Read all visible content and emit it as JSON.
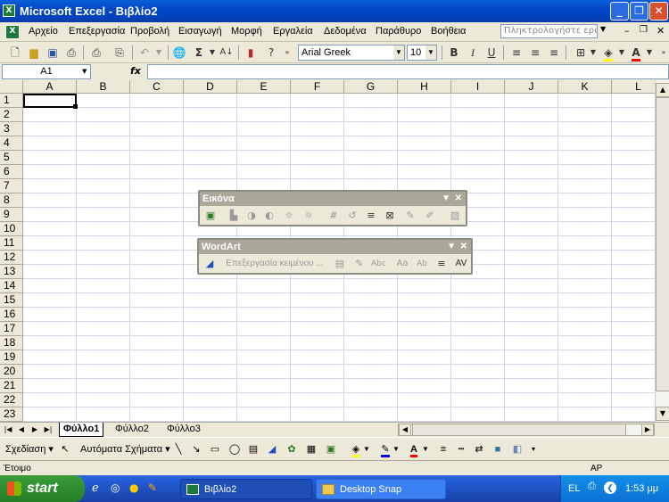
{
  "window": {
    "title": "Microsoft Excel - Βιβλίο2"
  },
  "menu": {
    "items": [
      "Αρχείο",
      "Επεξεργασία",
      "Προβολή",
      "Εισαγωγή",
      "Μορφή",
      "Εργαλεία",
      "Δεδομένα",
      "Παράθυρο",
      "Βοήθεια"
    ],
    "help_placeholder": "Πληκτρολογήστε ερώτηση"
  },
  "formatting": {
    "font": "Arial Greek",
    "size": "10"
  },
  "formula_bar": {
    "name_box": "A1",
    "fx": "fx"
  },
  "grid": {
    "columns": [
      "A",
      "B",
      "C",
      "D",
      "E",
      "F",
      "G",
      "H",
      "I",
      "J",
      "K",
      "L"
    ],
    "rows": [
      "1",
      "2",
      "3",
      "4",
      "5",
      "6",
      "7",
      "8",
      "9",
      "10",
      "11",
      "12",
      "13",
      "14",
      "15",
      "16",
      "17",
      "18",
      "19",
      "20",
      "21",
      "22",
      "23"
    ]
  },
  "picture_toolbar": {
    "title": "Εικόνα"
  },
  "wordart_toolbar": {
    "title": "WordArt",
    "edit_text": "Επεξεργασία κειμένου ..."
  },
  "sheets": {
    "tabs": [
      "Φύλλο1",
      "Φύλλο2",
      "Φύλλο3"
    ],
    "active": "Φύλλο1"
  },
  "drawing": {
    "draw_label": "Σχεδίαση",
    "autoshapes_label": "Αυτόματα Σχήματα"
  },
  "status": {
    "left": "Έτοιμο",
    "right": "ΑΡ"
  },
  "taskbar": {
    "start": "start",
    "tasks": [
      "Βιβλίο2",
      "Desktop Snap"
    ],
    "lang": "EL",
    "clock": "1:53 μμ"
  },
  "colors": {
    "fill": "#ffff00",
    "font": "#ff0000",
    "line": "#0000ff"
  }
}
